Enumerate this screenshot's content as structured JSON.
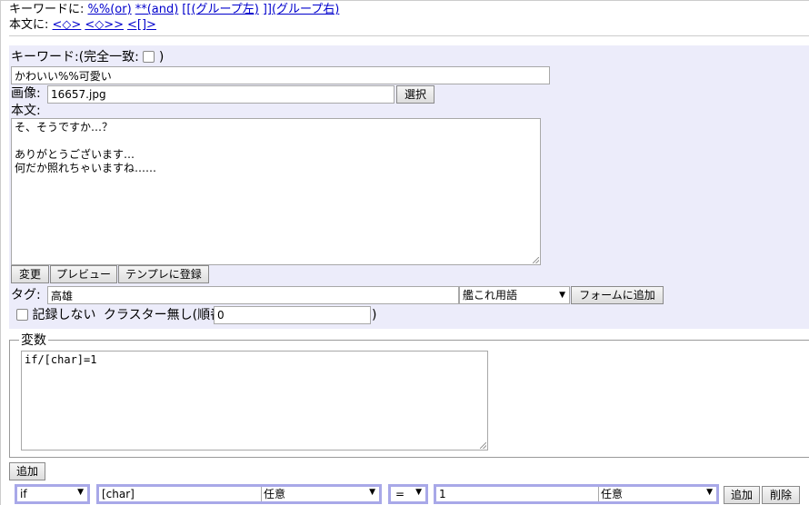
{
  "nav": {
    "keyword_label": "キーワードに:",
    "keyword_links": [
      "%%(or)",
      "**(and)",
      "[[(グループ左)",
      "]](グループ右)"
    ],
    "body_label": "本文に:",
    "body_links": [
      "<◇>",
      "<◇>>",
      "<[]>"
    ]
  },
  "form": {
    "keyword_label": "キーワード:(完全一致:",
    "keyword_label_close": ")",
    "keyword_value": "かわいい%%可愛い",
    "image_label": "画像:",
    "image_value": "16657.jpg",
    "select_button": "選択",
    "body_label": "本文:",
    "body_value": "そ、そうですか…？\n\nありがとうございます…\n何だか照れちゃいますね……",
    "buttons": [
      "変更",
      "プレビュー",
      "テンプレに登録"
    ],
    "tag_label": "タグ:",
    "tag_value": "高雄",
    "tag_select": "艦これ用語",
    "add_to_form_button": "フォームに追加",
    "no_record_label": "記録しない",
    "cluster_label": "クラスター無し(順番",
    "order_value": "0",
    "order_close": ")"
  },
  "variables": {
    "legend": "変数",
    "value": "if/[char]=1",
    "add_button": "追加"
  },
  "condition_row": {
    "type_select": "if",
    "var_value": "[char]",
    "var_mode_select": "任意",
    "op_select": "=",
    "value_value": "1",
    "value_mode_select": "任意",
    "add_button": "追加",
    "delete_button": "削除"
  },
  "colors": {
    "panel_bg": "#ececfa",
    "link": "#0000cc",
    "condition_border": "#a8a8e8"
  },
  "icons": [
    "checkbox",
    "dropdown-arrow-icon",
    "resize-grip-icon"
  ]
}
